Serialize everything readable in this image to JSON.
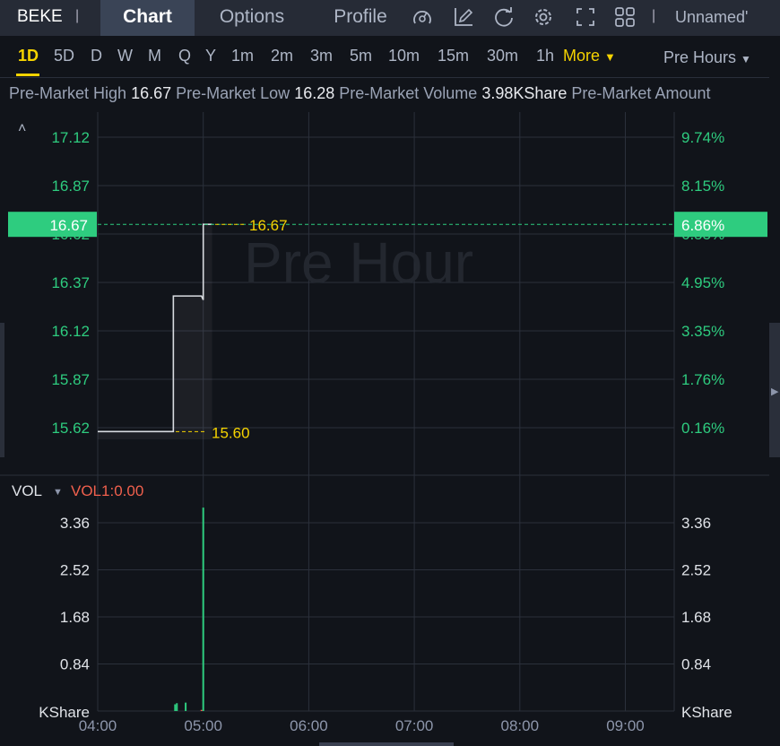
{
  "header": {
    "symbol": "BEKE",
    "tabs": [
      {
        "label": "Chart",
        "active": true
      },
      {
        "label": "Options"
      },
      {
        "label": "Profile"
      }
    ],
    "icons": [
      "indicator-gauge-icon",
      "draw-pencil-icon",
      "refresh-icon",
      "settings-gear-icon",
      "fullscreen-icon",
      "layout-grid-icon"
    ],
    "layout_name": "Unnamed'"
  },
  "periods": {
    "items": [
      "1D",
      "5D",
      "D",
      "W",
      "M",
      "Q",
      "Y",
      "1m",
      "2m",
      "3m",
      "5m",
      "10m",
      "15m",
      "30m",
      "1h"
    ],
    "active": "1D",
    "more_label": "More",
    "session_label": "Pre Hours"
  },
  "info": {
    "high_label": "Pre-Market High",
    "high": "16.67",
    "low_label": "Pre-Market Low",
    "low": "16.28",
    "volume_label": "Pre-Market Volume",
    "volume": "3.98KShare",
    "amount_label": "Pre-Market Amount"
  },
  "colors": {
    "up": "#2ecc7f",
    "down": "#f0604d",
    "accent": "#f5d300",
    "grid": "#2b303b"
  },
  "chart_data": [
    {
      "type": "line",
      "watermark": "Pre Hour",
      "x": [
        "04:00",
        "04:43",
        "04:43",
        "04:59",
        "05:00",
        "05:00",
        "05:05"
      ],
      "y": [
        15.6,
        15.6,
        16.3,
        16.3,
        16.28,
        16.67,
        16.67
      ],
      "yticks": [
        "17.12",
        "16.87",
        "16.62",
        "16.37",
        "16.12",
        "15.87",
        "15.62"
      ],
      "pct_ticks": [
        "9.74%",
        "8.15%",
        "6.55%",
        "4.95%",
        "3.35%",
        "1.76%",
        "0.16%"
      ],
      "ylim": [
        15.55,
        17.2
      ],
      "last_price": "16.67",
      "last_pct": "6.86%",
      "max_label": "16.67",
      "min_label": "15.60"
    },
    {
      "type": "bar",
      "title": "VOL",
      "indicator": "VOL1:0.00",
      "unit": "KShare",
      "x": [
        "04:44",
        "04:45",
        "04:50",
        "04:59",
        "05:00"
      ],
      "values": [
        0.12,
        0.14,
        0.15,
        0.02,
        3.63
      ],
      "colors": [
        "up",
        "up",
        "up",
        "down",
        "up"
      ],
      "yticks": [
        "3.36",
        "2.52",
        "1.68",
        "0.84"
      ],
      "xticks": [
        "04:00",
        "05:00",
        "06:00",
        "07:00",
        "08:00",
        "09:00"
      ]
    }
  ]
}
